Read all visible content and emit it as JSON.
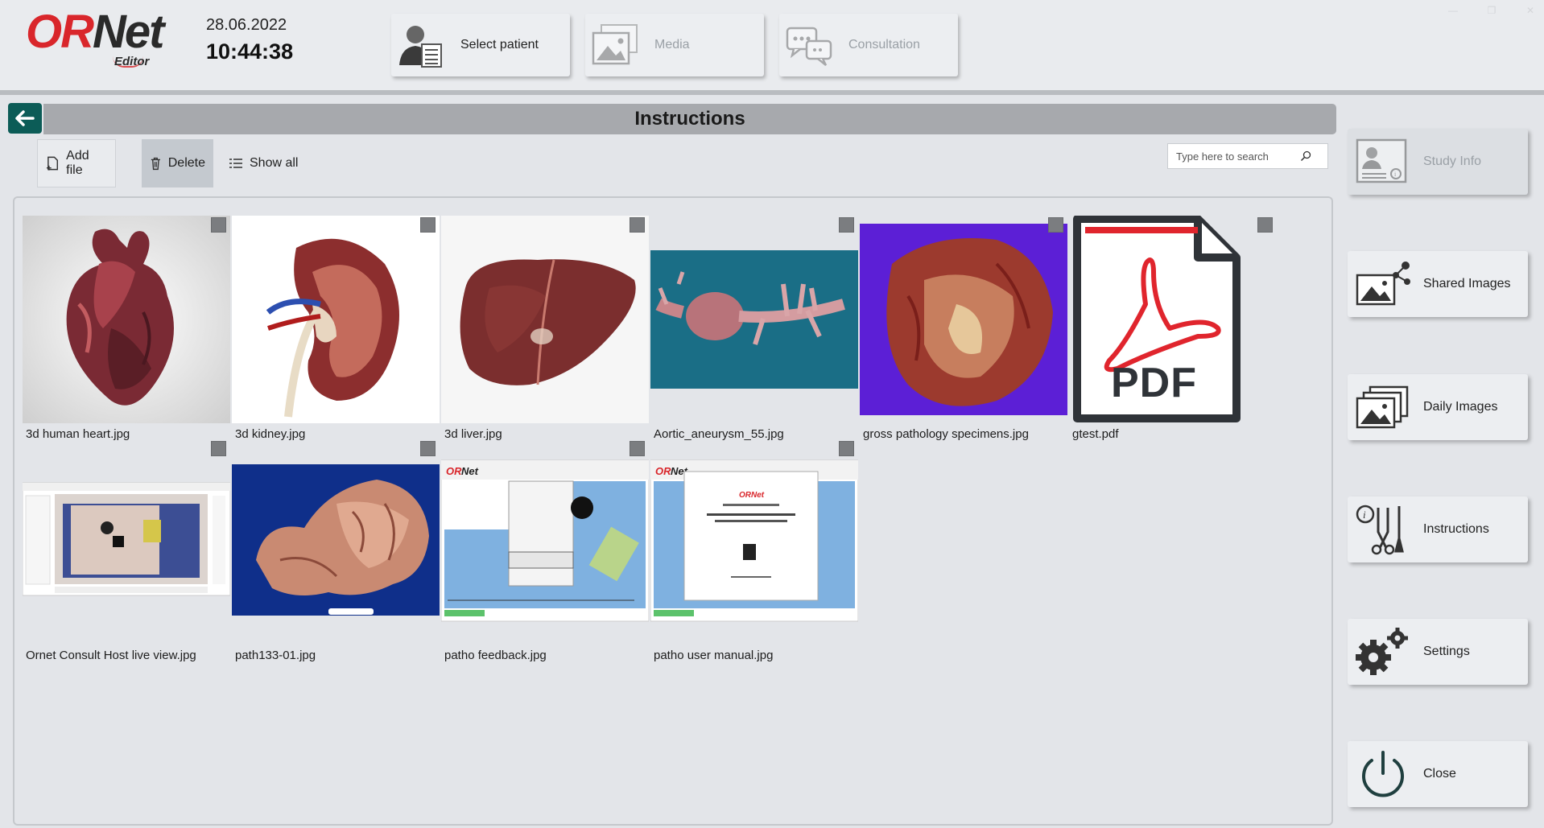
{
  "app": {
    "logo_main_1": "OR",
    "logo_main_2": "Net",
    "logo_sub": "Editor",
    "date": "28.06.2022",
    "time": "10:44:38"
  },
  "top_nav": [
    {
      "label": "Select patient",
      "icon": "patient-list-icon",
      "enabled": true
    },
    {
      "label": "Media",
      "icon": "media-icon",
      "enabled": false
    },
    {
      "label": "Consultation",
      "icon": "consultation-chat-icon",
      "enabled": false
    }
  ],
  "page": {
    "title": "Instructions"
  },
  "toolbar": {
    "add_file": "Add file",
    "delete": "Delete",
    "show_all": "Show all"
  },
  "search": {
    "placeholder": "Type here to search"
  },
  "files": [
    {
      "name": "3d human heart.jpg"
    },
    {
      "name": "3d kidney.jpg"
    },
    {
      "name": "3d liver.jpg"
    },
    {
      "name": "Aortic_aneurysm_55.jpg"
    },
    {
      "name": "gross pathology specimens.jpg"
    },
    {
      "name": "gtest.pdf"
    },
    {
      "name": "Ornet Consult Host live view.jpg"
    },
    {
      "name": "path133-01.jpg"
    },
    {
      "name": "patho feedback.jpg"
    },
    {
      "name": "patho user manual.jpg"
    }
  ],
  "pdf_label": "PDF",
  "side_menu": [
    {
      "label": "Study Info",
      "icon": "study-info-icon",
      "enabled": false
    },
    {
      "label": "Shared Images",
      "icon": "shared-images-icon",
      "enabled": true
    },
    {
      "label": "Daily Images",
      "icon": "daily-images-icon",
      "enabled": true
    },
    {
      "label": "Instructions",
      "icon": "instructions-tools-icon",
      "enabled": true
    },
    {
      "label": "Settings",
      "icon": "settings-gears-icon",
      "enabled": true
    },
    {
      "label": "Close",
      "icon": "power-icon",
      "enabled": true
    }
  ],
  "colors": {
    "accent_teal": "#0c5c57",
    "brand_red": "#d9262b",
    "title_bar": "#a7a9ad",
    "background": "#e3e5e9"
  }
}
